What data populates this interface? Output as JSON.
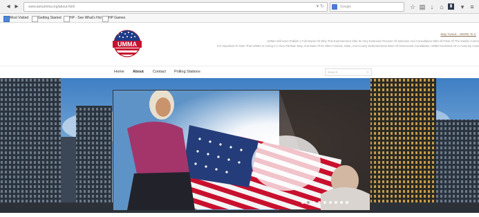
{
  "browser": {
    "url": "www.iamumma.org/about.html",
    "search_placeholder": "Google",
    "nav_back": "◂",
    "nav_forward": "▸",
    "bookmarks": [
      "Most Visited",
      "Getting Started",
      "HP - See What's Hot",
      "HP Games"
    ]
  },
  "site": {
    "logo_text": "UMMA",
    "top_link": "Stay Tuned... MORE To C",
    "announcement_line1": "UMMA Will Soon Publish A Full Report Of Why This Endorsement After Its Very Extensive Process Of Selection And Consultation With All Parts Of The Muslim Comm",
    "announcement_line2": "It Is Important To Note That UMMA Is Acting In A Non Partisan Way, And Most Of Its Other Federal, State, And County Endorsements Were Of Democratic Candidates. UMMA Endorses On A Case By Case",
    "nav": [
      "Home",
      "About",
      "Contact",
      "Polling Stations"
    ],
    "active_nav": "About",
    "search_placeholder": "Search"
  },
  "colors": {
    "logo_red": "#c8102e",
    "logo_blue": "#1f3c88",
    "sky": "#6fa6d9"
  },
  "slider": {
    "dot_count": 9,
    "active_dot": 1
  }
}
